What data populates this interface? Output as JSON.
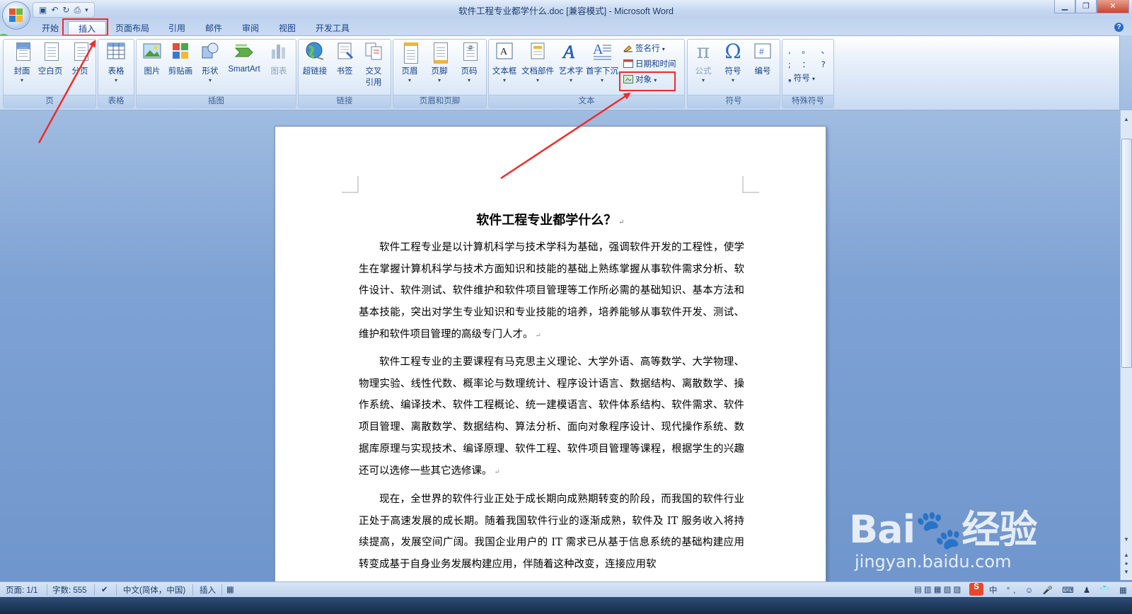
{
  "window": {
    "title": "软件工程专业都学什么.doc [兼容模式] - Microsoft Word",
    "qat_icons": [
      "save-icon",
      "undo-icon",
      "redo-icon",
      "print-preview-icon",
      "customize-qat-icon"
    ],
    "minimize": "0",
    "maximize": "1",
    "close": "r",
    "help": "?"
  },
  "badge": "65",
  "tabs": [
    {
      "label": "开始"
    },
    {
      "label": "插入",
      "active": true
    },
    {
      "label": "页面布局"
    },
    {
      "label": "引用"
    },
    {
      "label": "邮件"
    },
    {
      "label": "审阅"
    },
    {
      "label": "视图"
    },
    {
      "label": "开发工具"
    }
  ],
  "ribbon": {
    "groups": {
      "pages": {
        "label": "页",
        "cover": "封面",
        "blank": "空白页",
        "break": "分页"
      },
      "tables": {
        "label": "表格",
        "table": "表格"
      },
      "illustrations": {
        "label": "插图",
        "picture": "图片",
        "clipart": "剪贴画",
        "shapes": "形状",
        "smartart": "SmartArt",
        "chart": "图表"
      },
      "links": {
        "label": "链接",
        "hyperlink": "超链接",
        "bookmark": "书签",
        "crossref_1": "交叉",
        "crossref_2": "引用"
      },
      "header_footer": {
        "label": "页眉和页脚",
        "header": "页眉",
        "footer": "页脚",
        "page_number": "页码"
      },
      "text": {
        "label": "文本",
        "textbox": "文本框",
        "quickparts": "文档部件",
        "wordart": "艺术字",
        "dropcap": "首字下沉",
        "signature": "签名行",
        "datetime": "日期和时间",
        "object": "对象"
      },
      "symbols": {
        "label": "符号",
        "equation": "公式",
        "symbol": "符号",
        "number": "编号"
      },
      "special": {
        "label": "特殊符号",
        "row1": ", 。 、",
        "row2": "; ： ?",
        "symbol_menu": "符号"
      }
    }
  },
  "document": {
    "title": "软件工程专业都学什么？",
    "paragraphs": [
      "软件工程专业是以计算机科学与技术学科为基础，强调软件开发的工程性，使学生在掌握计算机科学与技术方面知识和技能的基础上熟练掌握从事软件需求分析、软件设计、软件测试、软件维护和软件项目管理等工作所必需的基础知识、基本方法和基本技能，突出对学生专业知识和专业技能的培养，培养能够从事软件开发、测试、维护和软件项目管理的高级专门人才。",
      "软件工程专业的主要课程有马克思主义理论、大学外语、高等数学、大学物理、物理实验、线性代数、概率论与数理统计、程序设计语言、数据结构、离散数学、操作系统、编译技术、软件工程概论、统一建模语言、软件体系结构、软件需求、软件项目管理、离散数学、数据结构、算法分析、面向对象程序设计、现代操作系统、数据库原理与实现技术、编译原理、软件工程、软件项目管理等课程，根据学生的兴趣还可以选修一些其它选修课。",
      "现在，全世界的软件行业正处于成长期向成熟期转变的阶段，而我国的软件行业正处于高速发展的成长期。随着我国软件行业的逐渐成熟，软件及 IT 服务收入将持续提高，发展空间广阔。我国企业用户的 IT 需求已从基于信息系统的基础构建应用转变成基于自身业务发展构建应用，伴随着这种改变，连接应用软"
    ],
    "paragraph_mark": "↵"
  },
  "statusbar": {
    "page": "页面: 1/1",
    "words": "字数: 555",
    "language": "中文(简体，中国)",
    "mode": "插入"
  },
  "watermark": {
    "main": "Bai🐾经验",
    "url": "jingyan.baidu.com"
  },
  "colors": {
    "highlight": "#ef2b2b",
    "accent": "#15428b"
  }
}
